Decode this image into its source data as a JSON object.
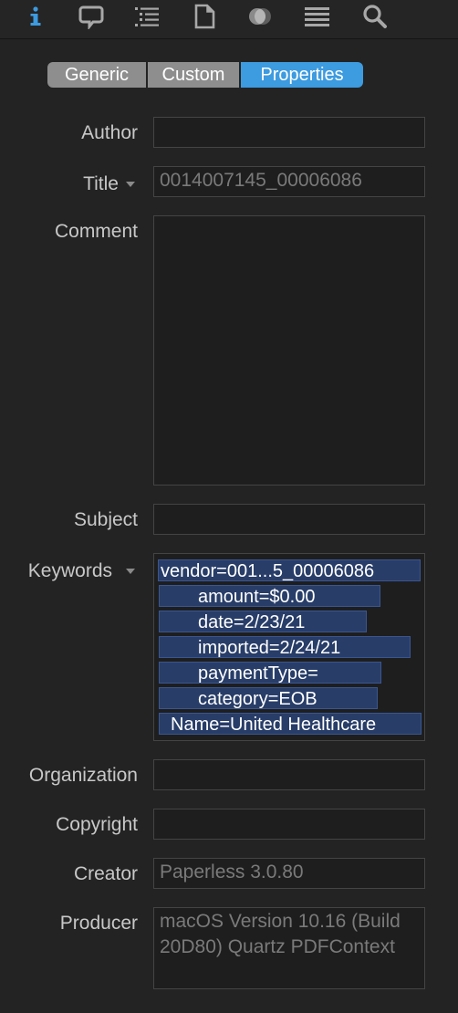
{
  "toolbar": {
    "icons": [
      "info-icon",
      "annotation-icon",
      "outline-icon",
      "page-icon",
      "circles-icon",
      "list-icon",
      "search-icon"
    ],
    "active_color": "#3d9be0",
    "icon_color": "#a8a8a8"
  },
  "tabs": {
    "generic": "Generic",
    "custom": "Custom",
    "properties": "Properties"
  },
  "fields": {
    "author": {
      "label": "Author",
      "value": ""
    },
    "title": {
      "label": "Title",
      "value": "0014007145_00006086"
    },
    "comment": {
      "label": "Comment",
      "value": ""
    },
    "subject": {
      "label": "Subject",
      "value": ""
    },
    "keywords": {
      "label": "Keywords",
      "tokens": [
        "vendor=001...5_00006086",
        "amount=$0.00",
        "date=2/23/21",
        "imported=2/24/21",
        "paymentType=",
        "category=EOB",
        "Name=United Healthcare"
      ]
    },
    "organization": {
      "label": "Organization",
      "value": ""
    },
    "copyright": {
      "label": "Copyright",
      "value": ""
    },
    "creator": {
      "label": "Creator",
      "value": "Paperless 3.0.80"
    },
    "producer": {
      "label": "Producer",
      "value": "macOS Version 10.16 (Build 20D80) Quartz PDFContext"
    }
  }
}
